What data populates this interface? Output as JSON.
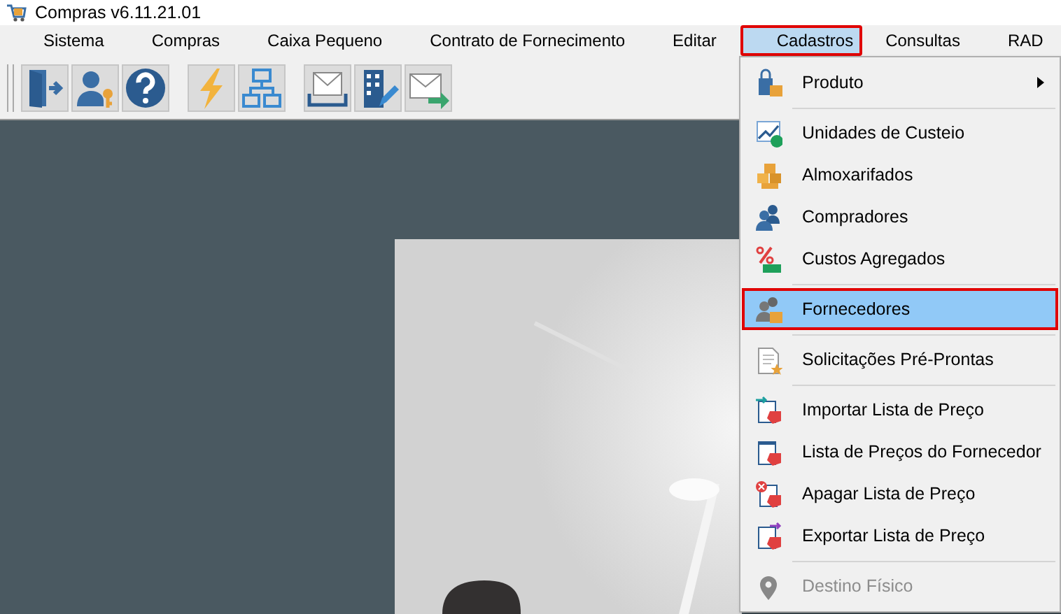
{
  "window": {
    "title": "Compras v6.11.21.01"
  },
  "menubar": [
    {
      "label": "Sistema",
      "selected": false,
      "outlined": false
    },
    {
      "label": "Compras",
      "selected": false,
      "outlined": false
    },
    {
      "label": "Caixa Pequeno",
      "selected": false,
      "outlined": false
    },
    {
      "label": "Contrato de Fornecimento",
      "selected": false,
      "outlined": false
    },
    {
      "label": "Editar",
      "selected": false,
      "outlined": false
    },
    {
      "label": "Cadastros",
      "selected": true,
      "outlined": true
    },
    {
      "label": "Consultas",
      "selected": false,
      "outlined": false
    },
    {
      "label": "RAD",
      "selected": false,
      "outlined": false
    }
  ],
  "menu": [
    {
      "kind": "item",
      "label": "Produto",
      "submenu": true,
      "selected": false,
      "outlined": false,
      "disabled": false
    },
    {
      "kind": "separator"
    },
    {
      "kind": "item",
      "label": "Unidades de Custeio",
      "submenu": false,
      "selected": false,
      "outlined": false,
      "disabled": false
    },
    {
      "kind": "item",
      "label": "Almoxarifados",
      "submenu": false,
      "selected": false,
      "outlined": false,
      "disabled": false
    },
    {
      "kind": "item",
      "label": "Compradores",
      "submenu": false,
      "selected": false,
      "outlined": false,
      "disabled": false
    },
    {
      "kind": "item",
      "label": "Custos Agregados",
      "submenu": false,
      "selected": false,
      "outlined": false,
      "disabled": false
    },
    {
      "kind": "separator"
    },
    {
      "kind": "item",
      "label": "Fornecedores",
      "submenu": false,
      "selected": true,
      "outlined": true,
      "disabled": false
    },
    {
      "kind": "separator"
    },
    {
      "kind": "item",
      "label": "Solicitações Pré-Prontas",
      "submenu": false,
      "selected": false,
      "outlined": false,
      "disabled": false
    },
    {
      "kind": "separator"
    },
    {
      "kind": "item",
      "label": "Importar Lista de Preço",
      "submenu": false,
      "selected": false,
      "outlined": false,
      "disabled": false
    },
    {
      "kind": "item",
      "label": "Lista de Preços do Fornecedor",
      "submenu": false,
      "selected": false,
      "outlined": false,
      "disabled": false
    },
    {
      "kind": "item",
      "label": "Apagar Lista de Preço",
      "submenu": false,
      "selected": false,
      "outlined": false,
      "disabled": false
    },
    {
      "kind": "item",
      "label": "Exportar Lista de Preço",
      "submenu": false,
      "selected": false,
      "outlined": false,
      "disabled": false
    },
    {
      "kind": "separator"
    },
    {
      "kind": "item",
      "label": "Destino Físico",
      "submenu": false,
      "selected": false,
      "outlined": false,
      "disabled": true
    }
  ]
}
